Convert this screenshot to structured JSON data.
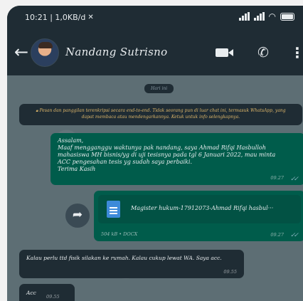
{
  "status_bar": {
    "time_and_speed": "10:21 | 1,0KB/d",
    "icons": [
      "wifi-off-icon",
      "signal-icon",
      "signal-icon",
      "wifi-icon",
      "battery-icon"
    ]
  },
  "header": {
    "back_icon": "arrow-left-icon",
    "contact_name": "Nandang Sutrisno",
    "video_icon": "video-call-icon",
    "call_icon": "phone-icon",
    "menu_icon": "more-vertical-icon"
  },
  "chat": {
    "date_chip": "Hari ini",
    "encryption_notice": "Pesan dan panggilan terenkripsi secara end-to-end. Tidak seorang pun di luar chat ini, termasuk WhatsApp, yang dapat membaca atau mendengarkannya. Ketuk untuk info selengkapnya.",
    "messages": [
      {
        "direction": "outgoing",
        "text": "Assalam,\nMaaf mengganggu waktunya pak nandang, saya Ahmad Rifqi Hasbulloh\nmahasiswa MH bisnis/yg di uji tesisnya pada tgl 6 Januari 2022, mau minta\nACC pengesahan tesis yg sudah saya perbaiki.\nTerima Kasih",
        "time": "09.27",
        "status": "read"
      },
      {
        "direction": "outgoing",
        "type": "document",
        "file_name": "Magister hukum-17912073-Ahmad Rifqi hasbul···",
        "file_meta": "504 kB • DOCX",
        "time": "09.27",
        "status": "read"
      },
      {
        "direction": "incoming",
        "text": "Kalau perlu ttd fisik silakan ke rumah. Kalau cukup lewat WA. Saya acc.",
        "time": "09.55"
      },
      {
        "direction": "incoming",
        "text": "Acc",
        "time": "09.55"
      }
    ]
  },
  "colors": {
    "header_bg": "#1f2c34",
    "outgoing_bubble": "#005c4b",
    "incoming_bubble": "#1f2c34",
    "notice_text": "#e0b86a",
    "read_ticks": "#8ab4c2"
  }
}
